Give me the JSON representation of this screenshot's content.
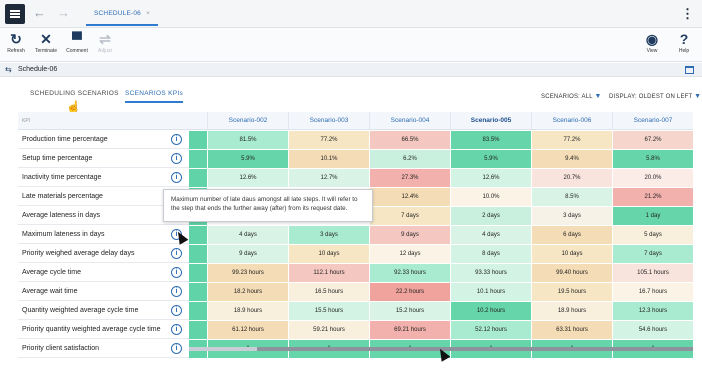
{
  "app": {
    "tab_title": "SCHEDULE-06",
    "tab_close": "×",
    "nav_back": "←",
    "nav_forward": "→",
    "menu_icon": "hamburger-icon",
    "more_icon": "⋮"
  },
  "toolbar": {
    "refresh": {
      "label": "Refresh",
      "icon": "↻"
    },
    "terminate": {
      "label": "Terminate",
      "icon": "✕"
    },
    "comment": {
      "label": "Comment",
      "icon": "▀"
    },
    "adjust": {
      "label": "Adjust",
      "icon": "⇌"
    },
    "view": {
      "label": "View",
      "icon": "◉"
    },
    "help": {
      "label": "Help",
      "icon": "?"
    }
  },
  "breadcrumb": {
    "icon": "⇆",
    "title": "Schedule-06"
  },
  "subtabs": {
    "scheduling": "SCHEDULING SCENARIOS",
    "kpis": "SCENARIOS KPIs"
  },
  "filters": {
    "scenarios": "SCENARIOS: ALL",
    "display": "DISPLAY: OLDEST ON LEFT"
  },
  "grid": {
    "kpi_header": "KPI",
    "scenarios": [
      {
        "name": "Scenario-002",
        "bold": false
      },
      {
        "name": "Scenario-003",
        "bold": false
      },
      {
        "name": "Scenario-004",
        "bold": false
      },
      {
        "name": "Scenario-005",
        "bold": true
      },
      {
        "name": "Scenario-006",
        "bold": false
      },
      {
        "name": "Scenario-007",
        "bold": false
      }
    ],
    "rows": [
      {
        "label": "Production time percentage",
        "strip": "#61d3a8",
        "cells": [
          [
            "81.5%",
            "#a9ebd1"
          ],
          [
            "77.2%",
            "#f6e6c4"
          ],
          [
            "66.5%",
            "#f4c8c0"
          ],
          [
            "83.5%",
            "#66d6aa"
          ],
          [
            "77.2%",
            "#f6e6c4"
          ],
          [
            "67.2%",
            "#f6d6cc"
          ]
        ]
      },
      {
        "label": "Setup time percentage",
        "strip": "#61d3a8",
        "cells": [
          [
            "5.9%",
            "#66d6aa"
          ],
          [
            "10.1%",
            "#f4dcb6"
          ],
          [
            "6.2%",
            "#c9f0de"
          ],
          [
            "5.9%",
            "#66d6aa"
          ],
          [
            "9.4%",
            "#f4dcb6"
          ],
          [
            "5.8%",
            "#66d6aa"
          ]
        ]
      },
      {
        "label": "Inactivity time percentage",
        "strip": "#61d3a8",
        "cells": [
          [
            "12.6%",
            "#d3f3e4"
          ],
          [
            "12.7%",
            "#d9f4e6"
          ],
          [
            "27.3%",
            "#f2b1ac"
          ],
          [
            "12.6%",
            "#d3f3e4"
          ],
          [
            "20.7%",
            "#f8e3dd"
          ],
          [
            "20.0%",
            "#fbece8"
          ]
        ]
      },
      {
        "label": "Late materials percentage",
        "strip": "#61d3a8",
        "cells": [
          [
            "",
            "#ffffff"
          ],
          [
            "",
            "#ffffff"
          ],
          [
            "12.4%",
            "#f4dcb6"
          ],
          [
            "10.0%",
            "#fbf4e6"
          ],
          [
            "8.5%",
            "#d9f4e6"
          ],
          [
            "21.2%",
            "#f2b1ac"
          ]
        ]
      },
      {
        "label": "Average lateness in days",
        "strip": "#61d3a8",
        "cells": [
          [
            "",
            "#ffffff"
          ],
          [
            "",
            "#ffffff"
          ],
          [
            "7 days",
            "#f6e6c4"
          ],
          [
            "2 days",
            "#c9f0de"
          ],
          [
            "3 days",
            "#f7f2e8"
          ],
          [
            "1 day",
            "#66d6aa"
          ]
        ]
      },
      {
        "label": "Maximum lateness in days",
        "strip": "#61d3a8",
        "cells": [
          [
            "4 days",
            "#d9f4e6"
          ],
          [
            "3 days",
            "#a9ebd1"
          ],
          [
            "9 days",
            "#f4c8c0"
          ],
          [
            "4 days",
            "#d9f4e6"
          ],
          [
            "6 days",
            "#f4dcb6"
          ],
          [
            "5 days",
            "#f8efdd"
          ]
        ]
      },
      {
        "label": "Priority weighed average delay days",
        "strip": "#61d3a8",
        "cells": [
          [
            "9 days",
            "#d9f4e6"
          ],
          [
            "10 days",
            "#f6e6c4"
          ],
          [
            "12 days",
            "#fbf4e6"
          ],
          [
            "8 days",
            "#d3f3e4"
          ],
          [
            "10 days",
            "#f6e6c4"
          ],
          [
            "7 days",
            "#a9ebd1"
          ]
        ]
      },
      {
        "label": "Average cycle time",
        "strip": "#61d3a8",
        "cells": [
          [
            "99.23 hours",
            "#f4dcb6"
          ],
          [
            "112.1 hours",
            "#f4c8c0"
          ],
          [
            "92.33 hours",
            "#a9ebd1"
          ],
          [
            "93.33 hours",
            "#d3f3e4"
          ],
          [
            "99.40 hours",
            "#f4dcb6"
          ],
          [
            "105.1 hours",
            "#f8e3dd"
          ]
        ]
      },
      {
        "label": "Average wait time",
        "strip": "#61d3a8",
        "cells": [
          [
            "18.2 hours",
            "#f4dcb6"
          ],
          [
            "16.5 hours",
            "#f8efdd"
          ],
          [
            "22.2 hours",
            "#f0a29c"
          ],
          [
            "10.1 hours",
            "#d3f3e4"
          ],
          [
            "19.5 hours",
            "#f6e6c4"
          ],
          [
            "16.7 hours",
            "#fbf4e6"
          ]
        ]
      },
      {
        "label": "Quantity weighted average cycle time",
        "strip": "#61d3a8",
        "cells": [
          [
            "18.9 hours",
            "#f8efdd"
          ],
          [
            "15.5 hours",
            "#d3f3e4"
          ],
          [
            "15.2 hours",
            "#d9f4e6"
          ],
          [
            "10.2 hours",
            "#66d6aa"
          ],
          [
            "18.9 hours",
            "#f8efdd"
          ],
          [
            "12.3 hours",
            "#a9ebd1"
          ]
        ]
      },
      {
        "label": "Priority quantity weighted average cycle time",
        "strip": "#61d3a8",
        "cells": [
          [
            "61.12 hours",
            "#f4dcb6"
          ],
          [
            "59.21 hours",
            "#f8efdd"
          ],
          [
            "69.21 hours",
            "#f2b1ac"
          ],
          [
            "52.12 hours",
            "#a9ebd1"
          ],
          [
            "63.31 hours",
            "#f4dcb6"
          ],
          [
            "54.6 hours",
            "#d3f3e4"
          ]
        ]
      },
      {
        "label": "Priority client satisfaction",
        "strip": "#61d3a8",
        "cells": [
          [
            "1",
            "#66d6aa"
          ],
          [
            "1",
            "#66d6aa"
          ],
          [
            "1",
            "#66d6aa"
          ],
          [
            "1",
            "#66d6aa"
          ],
          [
            "1",
            "#66d6aa"
          ],
          [
            "1",
            "#66d6aa"
          ]
        ]
      }
    ]
  },
  "tooltip": {
    "text": "Maximum number of late daus amongst all late steps. It will refer to the step that ends the further away (after) from its request date."
  },
  "colors": {
    "accent": "#2e7bcf",
    "good_strong": "#66d6aa",
    "bad_strong": "#f2b1ac",
    "neutral_warm": "#f4dcb6"
  }
}
